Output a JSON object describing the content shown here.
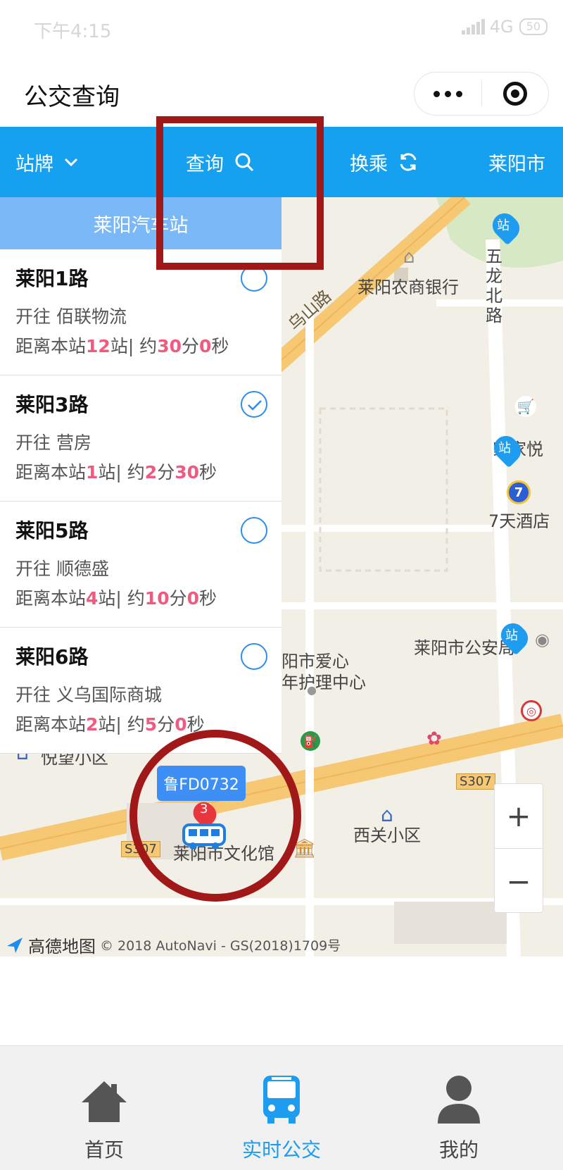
{
  "status_bar": {
    "time": "下午4:15",
    "network": "4G",
    "battery": "50"
  },
  "title_bar": {
    "title": "公交查询"
  },
  "toolbar": {
    "stop_board": "站牌",
    "query": "查询",
    "transfer": "换乘",
    "city": "莱阳市"
  },
  "stop": {
    "name": "莱阳汽车站"
  },
  "routes": [
    {
      "name": "莱阳1路",
      "dest_label": "开往",
      "dest": "佰联物流",
      "eta_prefix": "距离本站",
      "stops": "12",
      "stops_suffix": "站| 约",
      "min": "30",
      "min_suffix": "分",
      "sec": "0",
      "sec_suffix": "秒",
      "selected": false
    },
    {
      "name": "莱阳3路",
      "dest_label": "开往",
      "dest": "营房",
      "eta_prefix": "距离本站",
      "stops": "1",
      "stops_suffix": "站| 约",
      "min": "2",
      "min_suffix": "分",
      "sec": "30",
      "sec_suffix": "秒",
      "selected": true
    },
    {
      "name": "莱阳5路",
      "dest_label": "开往",
      "dest": "顺德盛",
      "eta_prefix": "距离本站",
      "stops": "4",
      "stops_suffix": "站| 约",
      "min": "10",
      "min_suffix": "分",
      "sec": "0",
      "sec_suffix": "秒",
      "selected": false
    },
    {
      "name": "莱阳6路",
      "dest_label": "开往",
      "dest": "义乌国际商城",
      "eta_prefix": "距离本站",
      "stops": "2",
      "stops_suffix": "站| 约",
      "min": "5",
      "min_suffix": "分",
      "sec": "0",
      "sec_suffix": "秒",
      "selected": false
    }
  ],
  "map": {
    "labels": {
      "bank": "莱阳农商银行",
      "road_wushan": "乌山路",
      "wulong_north": "五龙北路",
      "jiajiayue": "家家悦",
      "hotel": "7天酒店",
      "seven": "7",
      "police": "莱阳市公安局",
      "care_center": "阳市爱心\n年护理中心",
      "yuewang": "悦望小区",
      "xiguan": "西关小区",
      "culture_hall": "莱阳市文化馆",
      "s307_a": "S307",
      "s307_b": "S307",
      "stop_marker": "站",
      "north_road": "北路"
    },
    "bus": {
      "plate": "鲁FD0732",
      "stop_count": "3"
    },
    "zoom_in": "+",
    "zoom_out": "−",
    "amap_name": "高德地图",
    "attribution": "© 2018 AutoNavi - GS(2018)1709号"
  },
  "tabs": [
    {
      "label": "首页",
      "active": false
    },
    {
      "label": "实时公交",
      "active": true
    },
    {
      "label": "我的",
      "active": false
    }
  ],
  "colors": {
    "primary": "#16a0f0",
    "highlight": "#f05a7e",
    "annotation": "#a01818"
  }
}
